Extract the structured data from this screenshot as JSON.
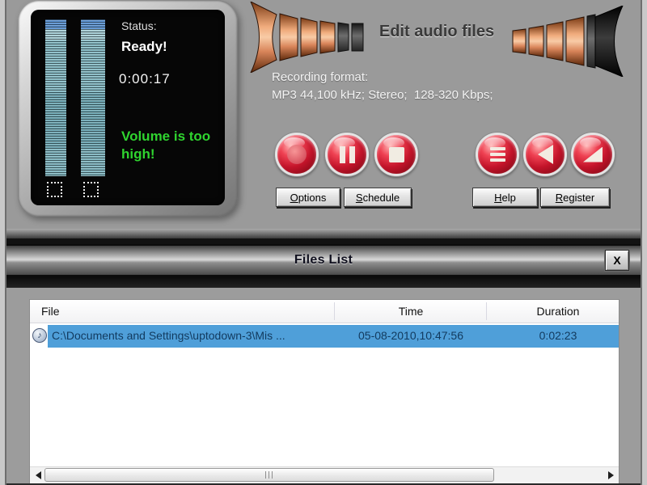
{
  "display": {
    "status_label": "Status:",
    "status_value": "Ready!",
    "elapsed_time": "0:00:17",
    "volume_warning": "Volume is too high!",
    "warning_color": "#2fd42f",
    "meter_cap_color": "#5b93d2",
    "meter_body_color": "#74afba"
  },
  "header": {
    "tagline": "Edit audio files",
    "recording_format_label": "Recording format:",
    "recording_format_value": "MP3 44,100 kHz; Stereo;  128-320 Kbps;"
  },
  "transport": {
    "accent_color": "#c3142a",
    "record_icon": "record-circle",
    "pause_icon": "pause-bars",
    "stop_icon": "stop-square",
    "menu_icon": "menu-lines",
    "sound_icon": "speaker-triangle",
    "volume_icon": "volume-ramp"
  },
  "buttons": {
    "options": "Options",
    "schedule": "Schedule",
    "help": "Help",
    "register": "Register"
  },
  "files_list": {
    "title": "Files List",
    "close_label": "X",
    "selection_color": "#4f9fd9",
    "columns": [
      "File",
      "Time",
      "Duration"
    ],
    "rows": [
      {
        "file": "C:\\Documents and Settings\\uptodown-3\\Mis ...",
        "time": "05-08-2010,10:47:56",
        "duration": "0:02:23"
      }
    ]
  },
  "icons": {
    "audio_file_glyph": "♪"
  }
}
